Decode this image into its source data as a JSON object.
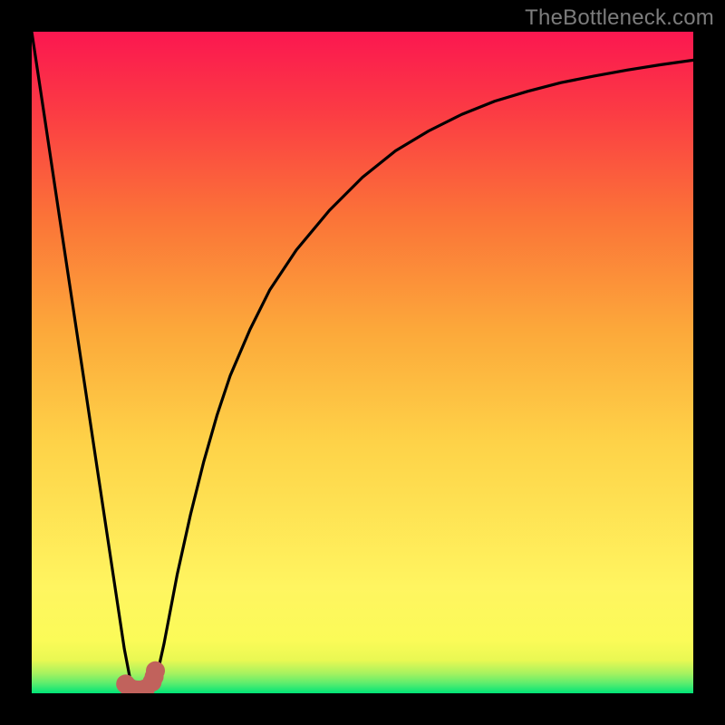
{
  "watermark": {
    "text": "TheBottleneck.com"
  },
  "chart_data": {
    "type": "line",
    "title": "",
    "xlabel": "",
    "ylabel": "",
    "xlim": [
      0,
      100
    ],
    "ylim": [
      0,
      100
    ],
    "series": [
      {
        "name": "curve",
        "x": [
          0,
          2,
          4,
          6,
          8,
          10,
          12,
          14,
          15,
          16,
          17,
          18,
          19,
          20,
          22,
          24,
          26,
          28,
          30,
          33,
          36,
          40,
          45,
          50,
          55,
          60,
          65,
          70,
          75,
          80,
          85,
          90,
          95,
          100
        ],
        "y": [
          100,
          86.7,
          73.3,
          60,
          46.7,
          33.3,
          20,
          6.7,
          1.5,
          0.5,
          0.5,
          1.0,
          3.0,
          7.5,
          18,
          27,
          35,
          42,
          48,
          55,
          61,
          67,
          73,
          78,
          82,
          85,
          87.5,
          89.5,
          91,
          92.3,
          93.3,
          94.2,
          95,
          95.7
        ]
      }
    ],
    "marker": {
      "name": "min-region-marker",
      "color": "#c1625c",
      "points": [
        {
          "x": 14.2,
          "y": 1.4
        },
        {
          "x": 14.7,
          "y": 0.9
        },
        {
          "x": 15.3,
          "y": 0.6
        },
        {
          "x": 15.9,
          "y": 0.5
        },
        {
          "x": 16.5,
          "y": 0.5
        },
        {
          "x": 17.2,
          "y": 0.7
        },
        {
          "x": 18.2,
          "y": 1.7
        },
        {
          "x": 18.5,
          "y": 2.5
        },
        {
          "x": 18.7,
          "y": 3.4
        }
      ]
    },
    "gradient_stops": [
      {
        "offset": 0.0,
        "color": "#00e477"
      },
      {
        "offset": 0.015,
        "color": "#5ced6e"
      },
      {
        "offset": 0.03,
        "color": "#a6f25f"
      },
      {
        "offset": 0.05,
        "color": "#e9f853"
      },
      {
        "offset": 0.08,
        "color": "#fbfb58"
      },
      {
        "offset": 0.16,
        "color": "#fff560"
      },
      {
        "offset": 0.38,
        "color": "#fed248"
      },
      {
        "offset": 0.55,
        "color": "#fca83a"
      },
      {
        "offset": 0.72,
        "color": "#fb7338"
      },
      {
        "offset": 0.88,
        "color": "#fb3b44"
      },
      {
        "offset": 1.0,
        "color": "#fb1750"
      }
    ]
  }
}
